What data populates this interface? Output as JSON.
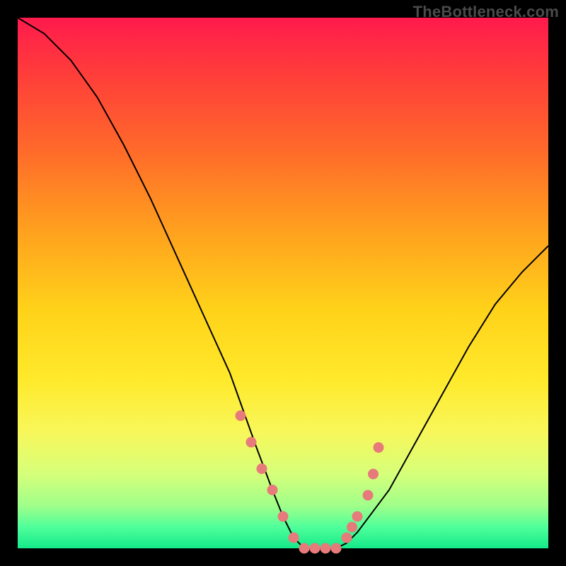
{
  "watermark": "TheBottleneck.com",
  "colors": {
    "dot": "#e77a7a",
    "curve": "#000000",
    "background_frame": "#000000"
  },
  "chart_data": {
    "type": "line",
    "title": "",
    "xlabel": "",
    "ylabel": "",
    "xlim": [
      0,
      100
    ],
    "ylim": [
      0,
      100
    ],
    "series": [
      {
        "name": "bottleneck-curve",
        "x": [
          0,
          5,
          10,
          15,
          20,
          25,
          30,
          35,
          40,
          45,
          48,
          50,
          52,
          54,
          56,
          58,
          60,
          62,
          64,
          70,
          75,
          80,
          85,
          90,
          95,
          100
        ],
        "y": [
          100,
          97,
          92,
          85,
          76,
          66,
          55,
          44,
          33,
          19,
          11,
          6,
          2,
          0,
          0,
          0,
          0,
          1,
          3,
          11,
          20,
          29,
          38,
          46,
          52,
          57
        ]
      }
    ],
    "highlight_points": {
      "name": "bottleneck-dots",
      "x": [
        42,
        44,
        46,
        48,
        50,
        52,
        54,
        56,
        58,
        60,
        62,
        63,
        64,
        66,
        67,
        68
      ],
      "y": [
        25,
        20,
        15,
        11,
        6,
        2,
        0,
        0,
        0,
        0,
        2,
        4,
        6,
        10,
        14,
        19
      ]
    }
  }
}
